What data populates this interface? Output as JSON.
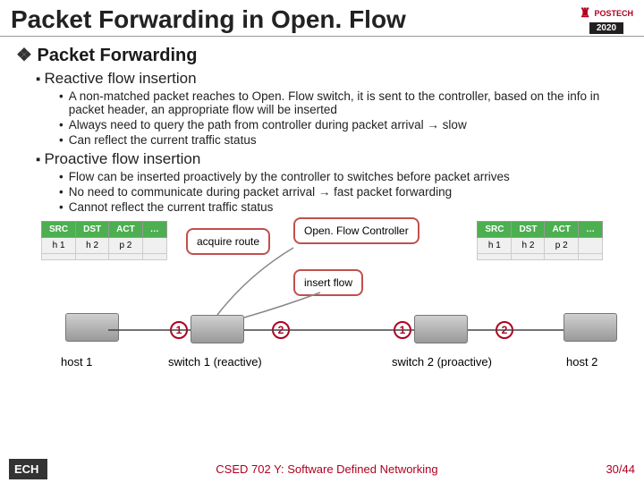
{
  "title": "Packet Forwarding in Open. Flow",
  "logo": {
    "top": "POSTECH",
    "bottom": "2020"
  },
  "h1": "Packet Forwarding",
  "reactive": {
    "heading": "Reactive flow insertion",
    "b1": "A non-matched packet reaches to Open. Flow switch, it is sent to the controller, based on the info in packet header, an appropriate flow will be inserted",
    "b2": "Always need to query the path from controller during packet arrival → slow",
    "b3": "Can reflect the current traffic status"
  },
  "proactive": {
    "heading": "Proactive flow insertion",
    "b1": "Flow can be inserted proactively by the controller to switches before packet arrives",
    "b2": "No need to communicate during packet arrival → fast packet forwarding",
    "b3": "Cannot reflect the current traffic status"
  },
  "table": {
    "headers": {
      "src": "SRC",
      "dst": "DST",
      "act": "ACT",
      "more": "…"
    },
    "row": {
      "src": "h 1",
      "dst": "h 2",
      "act": "p 2",
      "more": ""
    }
  },
  "callouts": {
    "acquire": "acquire route",
    "controller": "Open. Flow Controller",
    "insert": "insert flow"
  },
  "badges": {
    "one": "1",
    "two": "2"
  },
  "labels": {
    "h1": "host 1",
    "h2": "host 2",
    "sw1": "switch 1 (reactive)",
    "sw2": "switch 2 (proactive)"
  },
  "footer": {
    "left": "ECH",
    "center": "CSED 702 Y: Software Defined Networking",
    "right": "30/44"
  }
}
